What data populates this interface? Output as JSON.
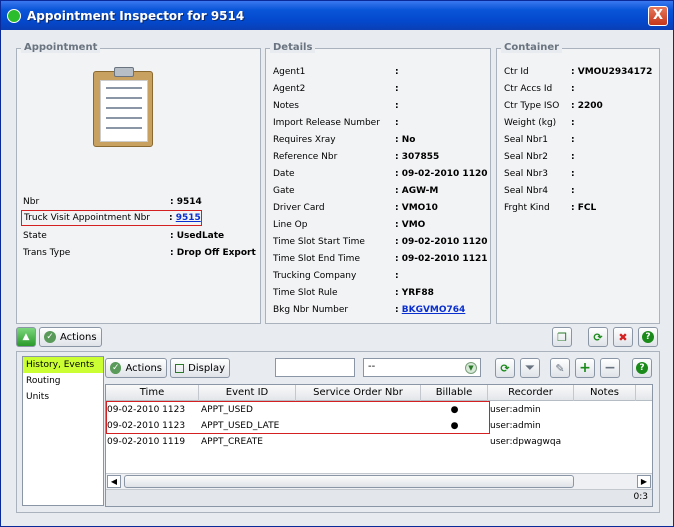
{
  "window": {
    "title": "Appointment Inspector for 9514",
    "close_label": "X"
  },
  "appointment": {
    "section_title": "Appointment",
    "fields": [
      {
        "label": "Nbr",
        "value": ": 9514"
      },
      {
        "label": "Truck Visit Appointment Nbr",
        "value_prefix": ": ",
        "value": "9515"
      },
      {
        "label": "State",
        "value": ": UsedLate"
      },
      {
        "label": "Trans Type",
        "value": ": Drop Off Export"
      }
    ]
  },
  "details": {
    "section_title": "Details",
    "fields": [
      {
        "label": "Agent1",
        "value": ":"
      },
      {
        "label": "Agent2",
        "value": ":"
      },
      {
        "label": "Notes",
        "value": ":"
      },
      {
        "label": "Import Release Number",
        "value": ":"
      },
      {
        "label": "Requires Xray",
        "value": ": No"
      },
      {
        "label": "Reference Nbr",
        "value": ": 307855"
      },
      {
        "label": "Date",
        "value": ": 09-02-2010 1120"
      },
      {
        "label": "Gate",
        "value": ": AGW-M"
      },
      {
        "label": "Driver Card",
        "value": ": VMO10"
      },
      {
        "label": "Line Op",
        "value": ": VMO"
      },
      {
        "label": "Time Slot Start Time",
        "value": ": 09-02-2010 1120"
      },
      {
        "label": "Time Slot End Time",
        "value": ": 09-02-2010 1121"
      },
      {
        "label": "Trucking Company",
        "value": ":"
      },
      {
        "label": "Time Slot Rule",
        "value": ": YRF88"
      },
      {
        "label": "Bkg Nbr Number",
        "value_prefix": ": ",
        "value": "BKGVMO764"
      }
    ]
  },
  "container": {
    "section_title": "Container",
    "fields": [
      {
        "label": "Ctr Id",
        "value": ": VMOU2934172"
      },
      {
        "label": "Ctr Accs Id",
        "value": ":"
      },
      {
        "label": "Ctr Type ISO",
        "value": ": 2200"
      },
      {
        "label": "Weight (kg)",
        "value": ":"
      },
      {
        "label": "Seal Nbr1",
        "value": ":"
      },
      {
        "label": "Seal Nbr2",
        "value": ":"
      },
      {
        "label": "Seal Nbr3",
        "value": ":"
      },
      {
        "label": "Seal Nbr4",
        "value": ":"
      },
      {
        "label": "Frght Kind",
        "value": ": FCL"
      }
    ]
  },
  "toolbar": {
    "actions_label": "Actions"
  },
  "bottom": {
    "nav": [
      "History, Events",
      "Routing",
      "Units"
    ],
    "actions_label": "Actions",
    "display_label": "Display",
    "search_value": "",
    "filter_value": "--",
    "columns": [
      "Time",
      "Event ID",
      "Service Order Nbr",
      "Billable",
      "Recorder",
      "Notes"
    ],
    "rows": [
      {
        "time": "09-02-2010 1123",
        "event": "APPT_USED",
        "order": "",
        "billable": "●",
        "recorder": "user:admin",
        "notes": ""
      },
      {
        "time": "09-02-2010 1123",
        "event": "APPT_USED_LATE",
        "order": "",
        "billable": "●",
        "recorder": "user:admin",
        "notes": ""
      },
      {
        "time": "09-02-2010 1119",
        "event": "APPT_CREATE",
        "order": "",
        "billable": "",
        "recorder": "user:dpwagwqa",
        "notes": ""
      }
    ],
    "count": "0:3"
  },
  "colors": {
    "title_bar": "#0a56d8",
    "highlight_border": "#d42020",
    "link": "#0a2fd0",
    "nav_selected": "#ccff33",
    "close": "#c5361a"
  }
}
